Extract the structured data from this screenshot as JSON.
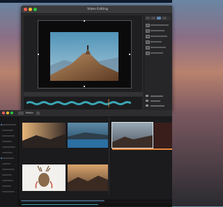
{
  "window": {
    "title": "Video Editing"
  },
  "viewer": {
    "image": "mountain-peak-photo"
  },
  "timeline": {
    "label": ""
  },
  "library": {
    "toolbar_label": "Media",
    "thumbnails": [
      {
        "name": "sunset-hills-thumb"
      },
      {
        "name": "blue-lake-thumb"
      },
      {
        "name": "coast-dusk-thumb"
      },
      {
        "name": "red-clip-thumb"
      },
      {
        "name": "deer-art-thumb"
      },
      {
        "name": "valley-sunrise-thumb"
      }
    ]
  },
  "colors": {
    "accent": "#e3e3e3",
    "selection": "#f08a3c",
    "waveform": "#3aa6b5"
  }
}
